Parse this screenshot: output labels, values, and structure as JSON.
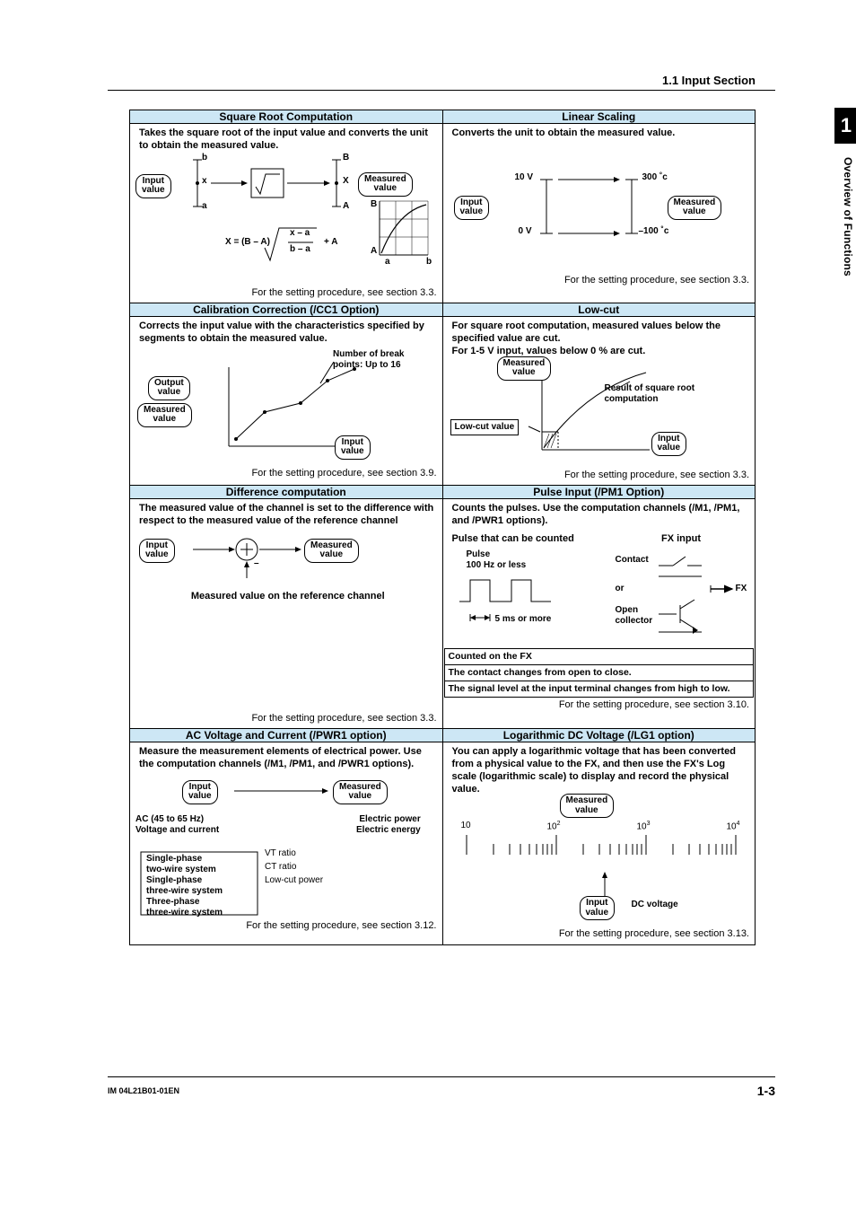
{
  "header": {
    "breadcrumb": "1.1  Input Section"
  },
  "tab": {
    "chapter_no": "1",
    "chapter_label": "Overview of Functions"
  },
  "footer": {
    "doc_id": "IM 04L21B01-01EN",
    "page_no": "1-3"
  },
  "cells": {
    "sqrt": {
      "title": "Square Root Computation",
      "desc": "Takes the square root of the input value and converts the unit to obtain the measured value.",
      "foot": "For the setting procedure, see section 3.3.",
      "labels": {
        "input": "Input\nvalue",
        "measured": "Measured\nvalue",
        "b_low": "b",
        "B_up": "B",
        "a_low": "a",
        "A_up": "A",
        "x_low": "x",
        "X_up": "X",
        "axA": "A",
        "axB": "B",
        "ax_a": "a",
        "ax_b": "b",
        "formula_lhs": "X = (B – A)",
        "formula_num": "x – a",
        "formula_den": "b – a",
        "formula_rhs": "+ A"
      }
    },
    "linear": {
      "title": "Linear Scaling",
      "desc": "Converts the unit to obtain the measured value.",
      "foot": "For the setting procedure, see section 3.3.",
      "labels": {
        "input": "Input\nvalue",
        "measured": "Measured\nvalue",
        "v10": "10 V",
        "v0": "0 V",
        "c300": "300 ˚c",
        "cminus100": "–100 ˚c"
      }
    },
    "calib": {
      "title": "Calibration Correction (/CC1 Option)",
      "desc": "Corrects the input value with the characteristics specified by segments to obtain the measured value.",
      "foot": "For the setting procedure, see section 3.9.",
      "labels": {
        "output": "Output\nvalue",
        "measured": "Measured\nvalue",
        "input": "Input\nvalue",
        "break": "Number of break points: Up to 16"
      }
    },
    "lowcut": {
      "title": "Low-cut",
      "desc1": "For square root computation, measured values below the specified value are cut.",
      "desc2": "For 1-5 V input, values below 0 % are cut.",
      "foot": "For the setting procedure, see section 3.3.",
      "labels": {
        "measured": "Measured\nvalue",
        "result": "Result of square root computation",
        "lowcut": "Low-cut value",
        "input": "Input\nvalue"
      }
    },
    "diff": {
      "title": "Difference computation",
      "desc": "The measured value of the channel is set to the difference with respect to the measured value of the reference channel",
      "caption": "Measured value on the reference channel",
      "foot": "For the setting procedure, see section 3.3.",
      "labels": {
        "input": "Input\nvalue",
        "measured": "Measured\nvalue",
        "minus": "–"
      }
    },
    "pulse": {
      "title": "Pulse Input (/PM1 Option)",
      "desc1": "Counts the pulses. Use the computation channels (/M1, /PM1, and /PWR1 options).",
      "heading": "Pulse that can be counted",
      "fxinput": "FX input",
      "foot": "For the setting procedure, see section 3.10.",
      "labels": {
        "pulse": "Pulse\n100 Hz or less",
        "t5ms": "5 ms or more",
        "contact": "Contact",
        "or": "or",
        "open": "Open collector",
        "fx": "FX",
        "counted": "Counted on the FX",
        "row1": "The contact changes from open to close.",
        "row2": "The signal level at the input terminal changes from high to low."
      }
    },
    "acv": {
      "title": "AC Voltage and Current (/PWR1 option)",
      "desc": "Measure the measurement elements of electrical power. Use the computation channels (/M1, /PM1, and /PWR1 options).",
      "foot": "For the setting procedure, see section 3.12.",
      "labels": {
        "input": "Input\nvalue",
        "measured": "Measured\nvalue",
        "h1": "AC (45 to 65 Hz)\nVoltage and current",
        "h2": "Electric power\nElectric energy",
        "sys": "Single-phase\ntwo-wire system\nSingle-phase\nthree-wire system\nThree-phase\nthree-wire system",
        "mid": "VT ratio\nCT ratio\nLow-cut power"
      }
    },
    "logdc": {
      "title": "Logarithmic DC Voltage (/LG1 option)",
      "desc": "You can apply a logarithmic voltage that has been converted from a physical value to the FX, and then use the FX's Log scale (logarithmic scale) to display and record the physical value.",
      "foot": "For the setting procedure, see section 3.13.",
      "labels": {
        "measured": "Measured\nvalue",
        "input": "Input\nvalue",
        "dc": "DC voltage",
        "t10": "10"
      }
    }
  }
}
